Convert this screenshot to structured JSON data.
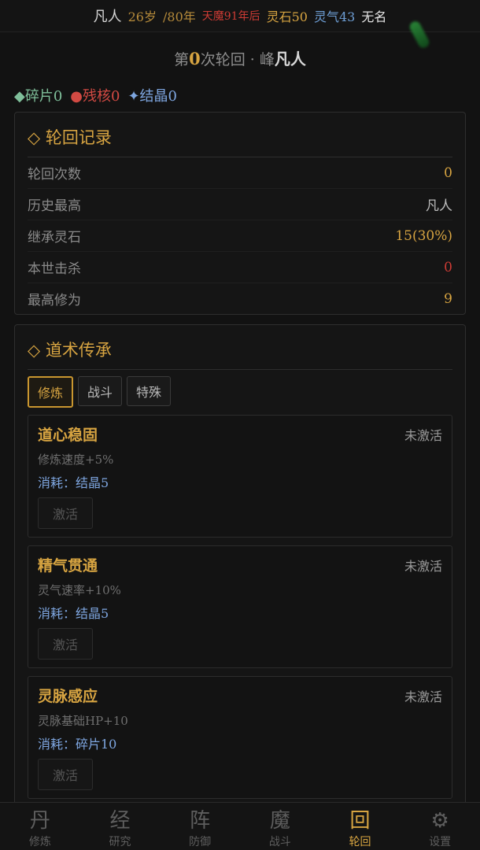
{
  "status": {
    "rank": "凡人",
    "age": "26岁",
    "lifespan": "/80年",
    "demon": "天魔91年后",
    "spirit_stone": "灵石50",
    "qi": "灵气43",
    "name": "无名"
  },
  "cycle": {
    "prefix": "第",
    "count": "0",
    "middle": "次轮回 · 峰",
    "peak": "凡人"
  },
  "resources": {
    "shard": "◆碎片0",
    "core": "●残核0",
    "crystal": "✦结晶0"
  },
  "record": {
    "title": "◇ 轮回记录",
    "rows": [
      {
        "label": "轮回次数",
        "value": "0"
      },
      {
        "label": "历史最高",
        "value": "凡人"
      },
      {
        "label": "继承灵石",
        "value": "15(30%)"
      },
      {
        "label": "本世击杀",
        "value": "0"
      },
      {
        "label": "最高修为",
        "value": "9"
      }
    ]
  },
  "inherit": {
    "title": "◇ 道术传承",
    "tabs": [
      "修炼",
      "战斗",
      "特殊"
    ],
    "skills": [
      {
        "name": "道心稳固",
        "status": "未激活",
        "desc": "修炼速度+5%",
        "cost": "消耗：结晶5",
        "button": "激活"
      },
      {
        "name": "精气贯通",
        "status": "未激活",
        "desc": "灵气速率+10%",
        "cost": "消耗：结晶5",
        "button": "激活"
      },
      {
        "name": "灵脉感应",
        "status": "未激活",
        "desc": "灵脉基础HP+10",
        "cost": "消耗：碎片10",
        "button": "激活"
      }
    ]
  },
  "nav": [
    {
      "icon": "丹",
      "label": "修炼"
    },
    {
      "icon": "经",
      "label": "研究"
    },
    {
      "icon": "阵",
      "label": "防御"
    },
    {
      "icon": "魔",
      "label": "战斗"
    },
    {
      "icon": "回",
      "label": "轮回"
    },
    {
      "icon": "⚙",
      "label": "设置"
    }
  ],
  "colors": {
    "accent_gold": "#d7a441",
    "danger_red": "#cc3b34",
    "crystal_blue": "#7ea6e0",
    "shard_green": "#7fbf9a"
  }
}
